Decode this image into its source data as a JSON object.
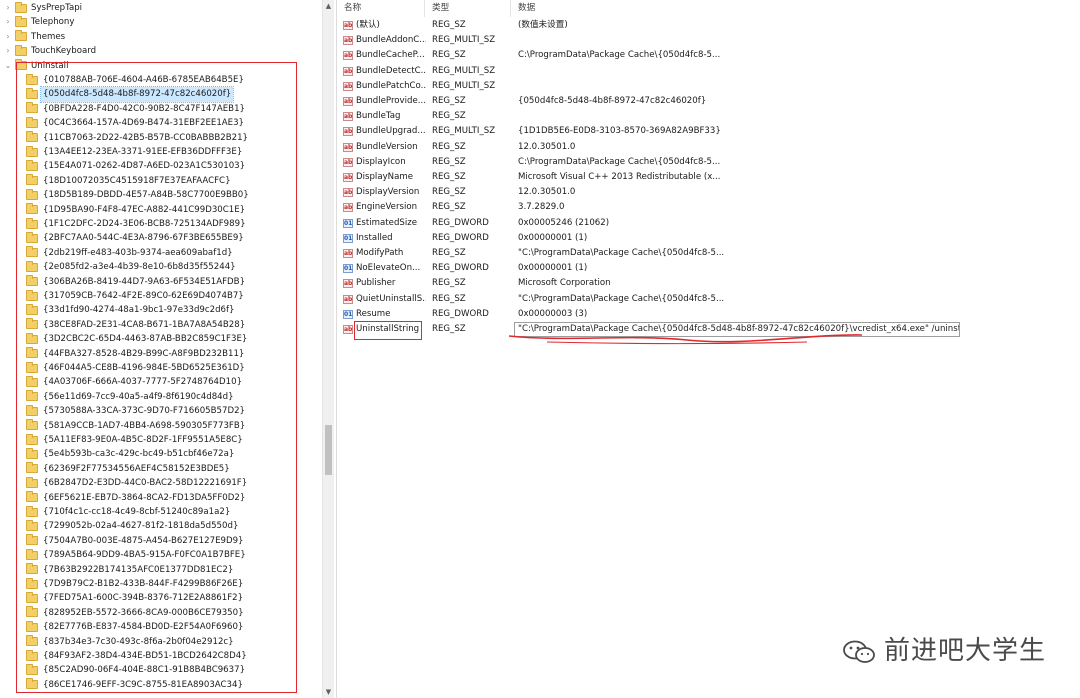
{
  "tree": {
    "top_items": [
      {
        "label": "SysPrepTapi",
        "expanded": false
      },
      {
        "label": "Telephony",
        "expanded": false
      },
      {
        "label": "Themes",
        "expanded": false
      },
      {
        "label": "TouchKeyboard",
        "expanded": false
      },
      {
        "label": "Uninstall",
        "expanded": true
      }
    ],
    "uninstall_children": [
      "{010788AB-706E-4604-A46B-6785EAB64B5E}",
      "{050d4fc8-5d48-4b8f-8972-47c82c46020f}",
      "{0BFDA228-F4D0-42C0-90B2-8C47F147AEB1}",
      "{0C4C3664-157A-4D69-B474-31EBF2EE1AE3}",
      "{11CB7063-2D22-42B5-B57B-CC0BABBB2B21}",
      "{13A4EE12-23EA-3371-91EE-EFB36DDFFF3E}",
      "{15E4A071-0262-4D87-A6ED-023A1C530103}",
      "{18D10072035C4515918F7E37EAFAACFC}",
      "{18D5B189-DBDD-4E57-A84B-58C7700E9BB0}",
      "{1D95BA90-F4F8-47EC-A882-441C99D30C1E}",
      "{1F1C2DFC-2D24-3E06-BCB8-725134ADF989}",
      "{2BFC7AA0-544C-4E3A-8796-67F3BE655BE9}",
      "{2db219ff-e483-403b-9374-aea609abaf1d}",
      "{2e085fd2-a3e4-4b39-8e10-6b8d35f55244}",
      "{306BA26B-8419-44D7-9A63-6F534E51AFDB}",
      "{317059CB-7642-4F2E-89C0-62E69D4074B7}",
      "{33d1fd90-4274-48a1-9bc1-97e33d9c2d6f}",
      "{38CE8FAD-2E31-4CA8-B671-1BA7A8A54B28}",
      "{3D2CBC2C-65D4-4463-87AB-BB2C859C1F3E}",
      "{44FBA327-8528-4B29-B99C-A8F9BD232B11}",
      "{46F044A5-CE8B-4196-984E-5BD6525E361D}",
      "{4A03706F-666A-4037-7777-5F2748764D10}",
      "{56e11d69-7cc9-40a5-a4f9-8f6190c4d84d}",
      "{5730588A-33CA-373C-9D70-F716605B57D2}",
      "{581A9CCB-1AD7-4BB4-A698-590305F773FB}",
      "{5A11EF83-9E0A-4B5C-8D2F-1FF9551A5E8C}",
      "{5e4b593b-ca3c-429c-bc49-b51cbf46e72a}",
      "{62369F2F77534556AEF4C58152E3BDE5}",
      "{6B2847D2-E3DD-44C0-BAC2-58D12221691F}",
      "{6EF5621E-EB7D-3864-8CA2-FD13DA5FF0D2}",
      "{710f4c1c-cc18-4c49-8cbf-51240c89a1a2}",
      "{7299052b-02a4-4627-81f2-1818da5d550d}",
      "{7504A7B0-003E-4875-A454-B627E127E9D9}",
      "{789A5B64-9DD9-4BA5-915A-F0FC0A1B7BFE}",
      "{7B63B2922B174135AFC0E1377DD81EC2}",
      "{7D9B79C2-B1B2-433B-844F-F4299B86F26E}",
      "{7FED75A1-600C-394B-8376-712E2A8861F2}",
      "{828952EB-5572-3666-8CA9-000B6CE79350}",
      "{82E7776B-E837-4584-BD0D-E2F54A0F6960}",
      "{837b34e3-7c30-493c-8f6a-2b0f04e2912c}",
      "{84F93AF2-38D4-434E-BD51-1BCD2642C8D4}",
      "{85C2AD90-06F4-404E-88C1-91B8B4BC9637}",
      "{86CE1746-9EFF-3C9C-8755-81EA8903AC34}"
    ],
    "selected_index": 1
  },
  "values": {
    "columns": {
      "name": "名称",
      "type": "类型",
      "data": "数据"
    },
    "rows": [
      {
        "name": "(默认)",
        "type": "REG_SZ",
        "data": "(数值未设置)",
        "kind": "sz"
      },
      {
        "name": "BundleAddonC...",
        "type": "REG_MULTI_SZ",
        "data": "",
        "kind": "sz"
      },
      {
        "name": "BundleCacheP...",
        "type": "REG_SZ",
        "data": "C:\\ProgramData\\Package Cache\\{050d4fc8-5...",
        "kind": "sz"
      },
      {
        "name": "BundleDetectC...",
        "type": "REG_MULTI_SZ",
        "data": "",
        "kind": "sz"
      },
      {
        "name": "BundlePatchCo...",
        "type": "REG_MULTI_SZ",
        "data": "",
        "kind": "sz"
      },
      {
        "name": "BundleProvide...",
        "type": "REG_SZ",
        "data": "{050d4fc8-5d48-4b8f-8972-47c82c46020f}",
        "kind": "sz"
      },
      {
        "name": "BundleTag",
        "type": "REG_SZ",
        "data": "",
        "kind": "sz"
      },
      {
        "name": "BundleUpgrad...",
        "type": "REG_MULTI_SZ",
        "data": "{1D1DB5E6-E0D8-3103-8570-369A82A9BF33}",
        "kind": "sz"
      },
      {
        "name": "BundleVersion",
        "type": "REG_SZ",
        "data": "12.0.30501.0",
        "kind": "sz"
      },
      {
        "name": "DisplayIcon",
        "type": "REG_SZ",
        "data": "C:\\ProgramData\\Package Cache\\{050d4fc8-5...",
        "kind": "sz"
      },
      {
        "name": "DisplayName",
        "type": "REG_SZ",
        "data": "Microsoft Visual C++ 2013 Redistributable (x...",
        "kind": "sz"
      },
      {
        "name": "DisplayVersion",
        "type": "REG_SZ",
        "data": "12.0.30501.0",
        "kind": "sz"
      },
      {
        "name": "EngineVersion",
        "type": "REG_SZ",
        "data": "3.7.2829.0",
        "kind": "sz"
      },
      {
        "name": "EstimatedSize",
        "type": "REG_DWORD",
        "data": "0x00005246 (21062)",
        "kind": "bin"
      },
      {
        "name": "Installed",
        "type": "REG_DWORD",
        "data": "0x00000001 (1)",
        "kind": "bin"
      },
      {
        "name": "ModifyPath",
        "type": "REG_SZ",
        "data": "\"C:\\ProgramData\\Package Cache\\{050d4fc8-5...",
        "kind": "sz"
      },
      {
        "name": "NoElevateOn...",
        "type": "REG_DWORD",
        "data": "0x00000001 (1)",
        "kind": "bin"
      },
      {
        "name": "Publisher",
        "type": "REG_SZ",
        "data": "Microsoft Corporation",
        "kind": "sz"
      },
      {
        "name": "QuietUninstallS...",
        "type": "REG_SZ",
        "data": "\"C:\\ProgramData\\Package Cache\\{050d4fc8-5...",
        "kind": "sz"
      },
      {
        "name": "Resume",
        "type": "REG_DWORD",
        "data": "0x00000003 (3)",
        "kind": "bin"
      },
      {
        "name": "UninstallString",
        "type": "REG_SZ",
        "data": "",
        "kind": "sz"
      }
    ],
    "edit_value": "\"C:\\ProgramData\\Package Cache\\{050d4fc8-5d48-4b8f-8972-47c82c46020f}\\vcredist_x64.exe\"  /uninstall"
  },
  "annotation_color": "#e0282e",
  "watermark": {
    "text": "前进吧大学生"
  }
}
